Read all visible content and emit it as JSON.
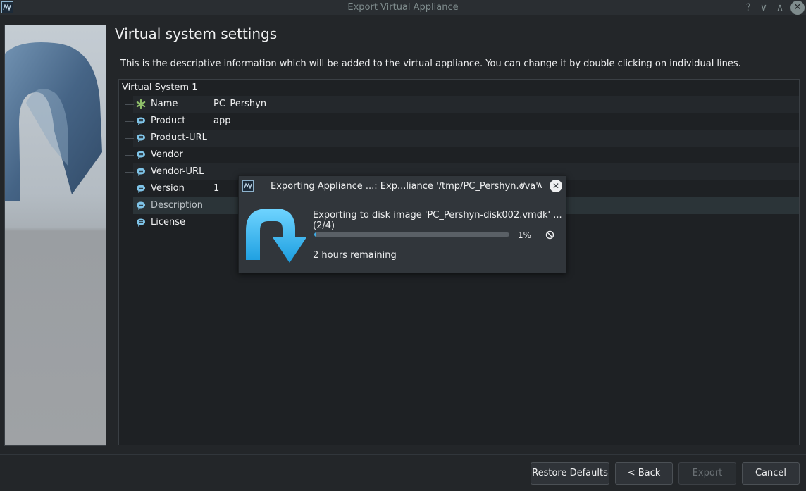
{
  "window": {
    "title": "Export Virtual Appliance",
    "buttons": {
      "help": "?",
      "minimize": "∨",
      "maximize": "∧",
      "close": "✕"
    }
  },
  "page": {
    "title": "Virtual system settings",
    "description": "This is the descriptive information which will be added to the virtual appliance. You can change it by double clicking on individual lines."
  },
  "tree": {
    "root": "Virtual System 1",
    "rows": [
      {
        "key": "Name",
        "value": "PC_Pershyn",
        "icon": "asterisk-icon"
      },
      {
        "key": "Product",
        "value": "app",
        "icon": "comment-icon"
      },
      {
        "key": "Product-URL",
        "value": "",
        "icon": "comment-icon"
      },
      {
        "key": "Vendor",
        "value": "",
        "icon": "comment-icon"
      },
      {
        "key": "Vendor-URL",
        "value": "",
        "icon": "comment-icon"
      },
      {
        "key": "Version",
        "value": "1",
        "icon": "comment-icon"
      },
      {
        "key": "Description",
        "value": "",
        "icon": "comment-icon"
      },
      {
        "key": "License",
        "value": "",
        "icon": "comment-icon"
      }
    ]
  },
  "footer": {
    "restore": "Restore Defaults",
    "back": "< Back",
    "export": "Export",
    "cancel": "Cancel"
  },
  "progress_dialog": {
    "title": "Exporting Appliance ...: Exp...liance '/tmp/PC_Pershyn.ova'",
    "operation": "Exporting to disk image 'PC_Pershyn-disk002.vmdk' ... (2/4)",
    "percent_label": "1%",
    "progress_fraction": 0.01,
    "remaining": "2 hours remaining",
    "buttons": {
      "minimize": "∨",
      "maximize": "∧",
      "close": "✕"
    }
  },
  "colors": {
    "accent": "#3daee9",
    "background": "#232629",
    "dialog_background": "#31363b",
    "icon_comment": "#7fc4e8",
    "icon_asterisk": "#8fbf6a"
  }
}
